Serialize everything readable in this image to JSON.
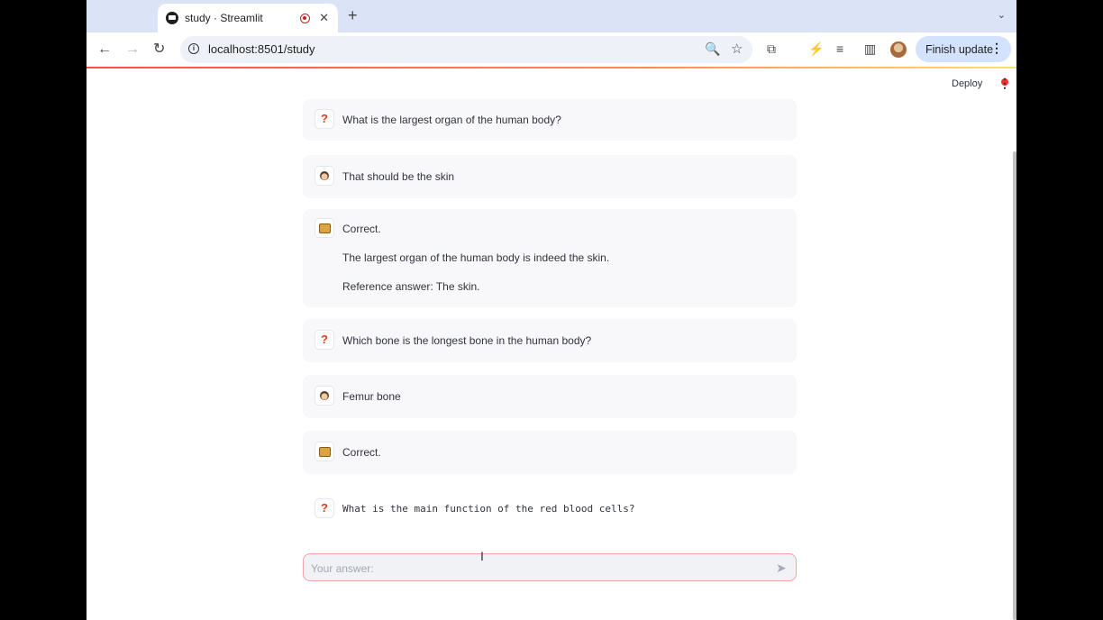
{
  "browser": {
    "tab_title": "study · Streamlit",
    "tab_close_glyph": "✕",
    "new_tab_glyph": "+",
    "tab_menu_glyph": "⌄",
    "back_glyph": "←",
    "forward_glyph": "→",
    "reload_glyph": "↻",
    "url": "localhost:8501/study",
    "info_glyph": "i",
    "zoom_glyph": "🔍",
    "star_glyph": "☆",
    "finish_update_label": "Finish update",
    "menu_glyph": "⋮"
  },
  "app": {
    "deploy_label": "Deploy",
    "menu_glyph": "⋮",
    "messages": [
      {
        "role": "question",
        "icon": "question-mark-icon",
        "glyph": "?",
        "lines": [
          "What is the largest organ of the human body?"
        ]
      },
      {
        "role": "user",
        "icon": "user-avatar-icon",
        "lines": [
          "That should be the skin"
        ]
      },
      {
        "role": "assistant",
        "icon": "bot-avatar-icon",
        "lines": [
          "Correct.",
          "The largest organ of the human body is indeed the skin.",
          "Reference answer: The skin."
        ]
      },
      {
        "role": "question",
        "icon": "question-mark-icon",
        "glyph": "?",
        "lines": [
          "Which bone is the longest bone in the human body?"
        ]
      },
      {
        "role": "user",
        "icon": "user-avatar-icon",
        "lines": [
          "Femur bone"
        ]
      },
      {
        "role": "assistant",
        "icon": "bot-avatar-icon",
        "lines": [
          "Correct."
        ]
      },
      {
        "role": "question",
        "icon": "question-mark-icon",
        "glyph": "?",
        "lines": [
          "What is the main function of the red blood cells?"
        ]
      }
    ],
    "answer_input": {
      "placeholder": "Your answer:",
      "value": ""
    },
    "send_glyph": "➤",
    "cursor_glyph": "I"
  },
  "colors": {
    "accent": "#ff4b4b",
    "question_icon": "#e03a1f",
    "finish_button": "#d3e3fd"
  }
}
